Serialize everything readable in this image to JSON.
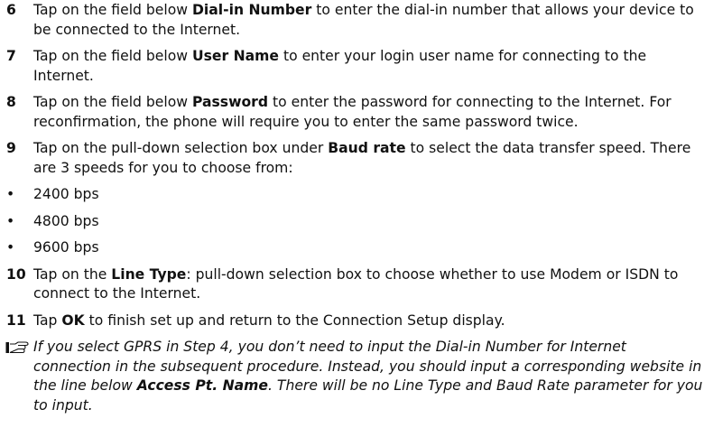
{
  "steps": [
    {
      "num": "6",
      "before": "Tap on the field below ",
      "bold": "Dial-in Number",
      "after": " to enter the dial-in number that allows your device to be connected to the Internet."
    },
    {
      "num": "7",
      "before": "Tap on the field below ",
      "bold": "User Name",
      "after": " to enter your login user name for connecting to the Internet."
    },
    {
      "num": "8",
      "before": "Tap on the field below ",
      "bold": "Password",
      "after": " to enter the password for connecting to the Internet. For reconfirmation, the phone will require you to enter the same password twice."
    },
    {
      "num": "9",
      "before": "Tap on the pull-down selection box under ",
      "bold": "Baud rate",
      "after": " to select the data transfer speed. There are 3 speeds for you to choose from:"
    }
  ],
  "bullets": [
    "2400 bps",
    "4800 bps",
    "9600 bps"
  ],
  "steps2": [
    {
      "num": "10",
      "before": "Tap on the ",
      "bold": "Line Type",
      "after": ": pull-down selection box to choose whether to use Modem or ISDN to connect to the Internet."
    },
    {
      "num": "11",
      "before": "Tap ",
      "bold": "OK",
      "after": " to finish set up and return to the Connection Setup display."
    }
  ],
  "note": {
    "icon": "note-hand-icon",
    "l1": "If you select GPRS in Step 4, you don’t need to input the Dial-in Number for Internet",
    "l2": "connection in the subsequent procedure. Instead, you should input a corresponding website in",
    "l3a": "the line below ",
    "l3b": "Access Pt. Name",
    "l3c": ". There will be no Line Type and Baud Rate parameter for you",
    "l4": "to input."
  }
}
